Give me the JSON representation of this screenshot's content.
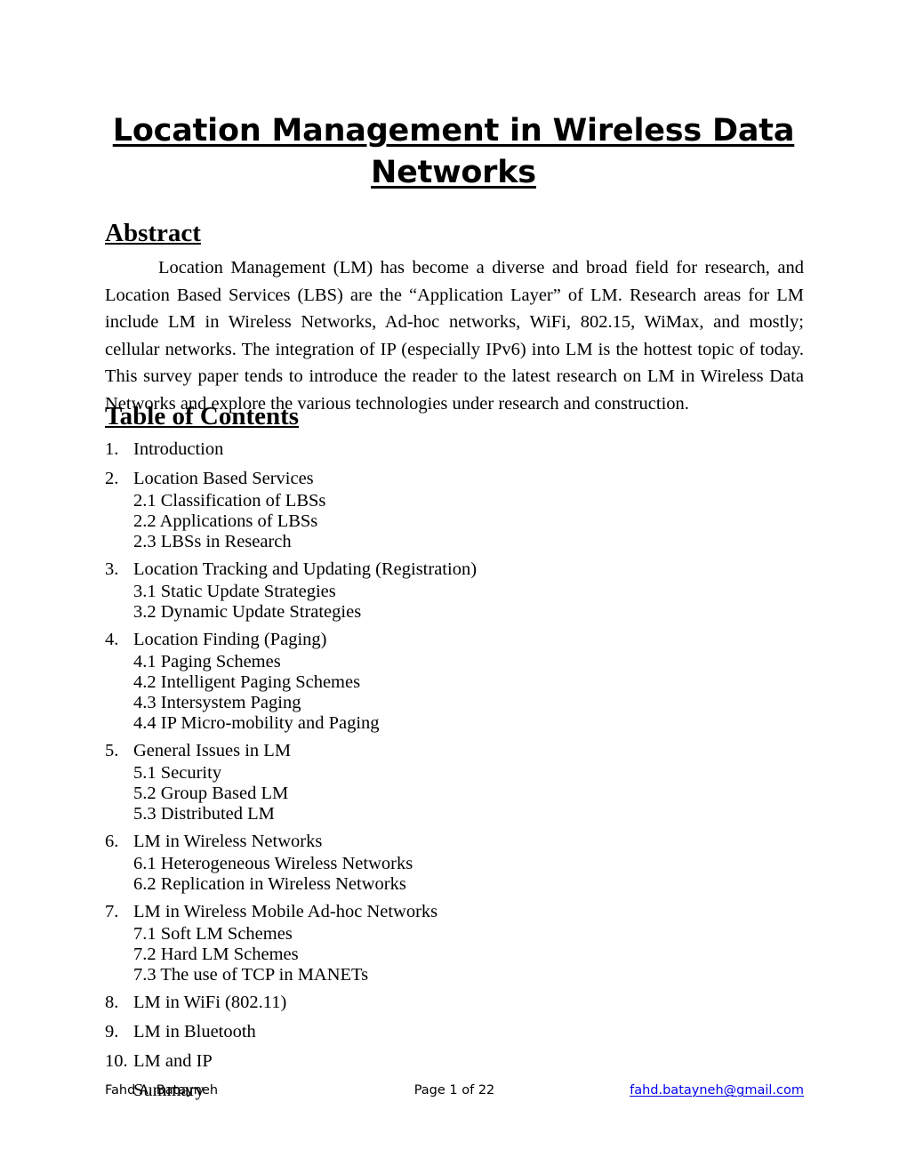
{
  "document": {
    "title_lines": [
      "Location Management in Wireless Data",
      "Networks"
    ],
    "abstract": {
      "heading": "Abstract",
      "body": "Location Management (LM) has become a diverse and broad field for research, and Location Based Services (LBS) are the “Application Layer” of LM. Research areas for LM include LM in Wireless Networks, Ad-hoc networks, WiFi, 802.15, WiMax, and mostly; cellular networks. The integration of IP (especially IPv6) into LM is the hottest topic of today. This survey paper tends to introduce the reader to the latest research on LM in Wireless Data Networks and explore the various technologies under research and construction."
    },
    "toc": {
      "heading": "Table of Contents",
      "entries": [
        {
          "number": "1.",
          "label": "Introduction",
          "subitems": []
        },
        {
          "number": "2.",
          "label": "Location Based Services",
          "subitems": [
            "2.1 Classification of LBSs",
            "2.2 Applications of LBSs",
            "2.3 LBSs in Research"
          ]
        },
        {
          "number": "3.",
          "label": "Location Tracking and Updating (Registration)",
          "subitems": [
            "3.1 Static Update Strategies",
            "3.2 Dynamic Update Strategies"
          ]
        },
        {
          "number": "4.",
          "label": "Location Finding (Paging)",
          "subitems": [
            "4.1 Paging Schemes",
            "4.2 Intelligent Paging Schemes",
            "4.3 Intersystem Paging",
            "4.4 IP Micro-mobility and Paging"
          ]
        },
        {
          "number": "5.",
          "label": "General Issues in LM",
          "subitems": [
            "5.1 Security",
            "5.2 Group Based LM",
            "5.3 Distributed LM"
          ]
        },
        {
          "number": "6.",
          "label": "LM in Wireless Networks",
          "subitems": [
            "6.1 Heterogeneous Wireless Networks",
            "6.2 Replication in Wireless Networks"
          ]
        },
        {
          "number": "7.",
          "label": "LM in Wireless Mobile Ad-hoc Networks",
          "subitems": [
            "7.1 Soft LM Schemes",
            "7.2 Hard LM Schemes",
            "7.3 The use of TCP in MANETs"
          ]
        },
        {
          "number": "8.",
          "label": "LM in WiFi (802.11)",
          "subitems": []
        },
        {
          "number": "9.",
          "label": "LM in Bluetooth",
          "subitems": []
        },
        {
          "number": "10.",
          "label": "LM and IP",
          "subitems": []
        }
      ],
      "trailing_item": "Summary"
    },
    "footer": {
      "author": "Fahd A. Batayneh",
      "page_label": "Page 1 of 22",
      "email": "fahd.batayneh@gmail.com",
      "email_color": "#0000ee"
    }
  }
}
